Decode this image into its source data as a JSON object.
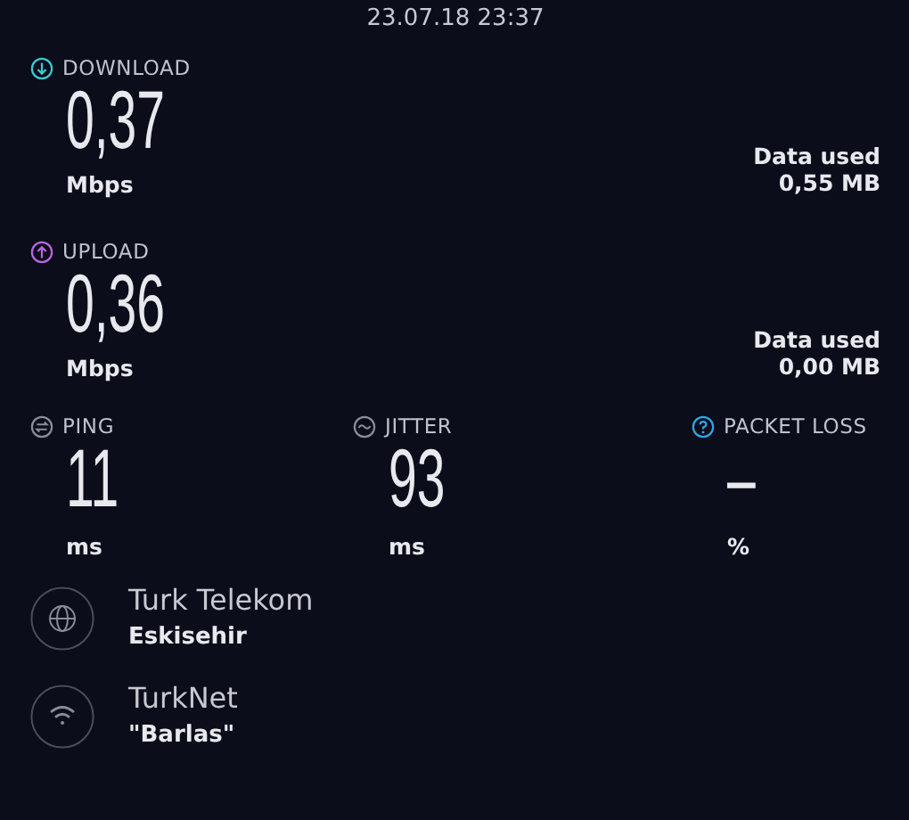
{
  "timestamp": "23.07.18 23:37",
  "speeds": [
    {
      "kind": "download",
      "label": "DOWNLOAD",
      "color": "#3cc9d0",
      "value": "0,37",
      "unit": "Mbps",
      "data_label": "Data used",
      "data_value": "0,55 MB"
    },
    {
      "kind": "upload",
      "label": "UPLOAD",
      "color": "#b866e0",
      "value": "0,36",
      "unit": "Mbps",
      "data_label": "Data used",
      "data_value": "0,00 MB"
    }
  ],
  "metrics": [
    {
      "kind": "ping",
      "label": "PING",
      "color": "#8a8d99",
      "value": "11",
      "unit": "ms"
    },
    {
      "kind": "jitter",
      "label": "JITTER",
      "color": "#8a8d99",
      "value": "93",
      "unit": "ms"
    },
    {
      "kind": "packet_loss",
      "label": "PACKET LOSS",
      "color": "#2ea6e6",
      "value": "–",
      "unit": "%"
    }
  ],
  "connections": [
    {
      "kind": "provider",
      "name": "Turk Telekom",
      "detail": "Eskisehir"
    },
    {
      "kind": "wifi",
      "name": "TurkNet",
      "detail": "\"Barlas\""
    }
  ]
}
